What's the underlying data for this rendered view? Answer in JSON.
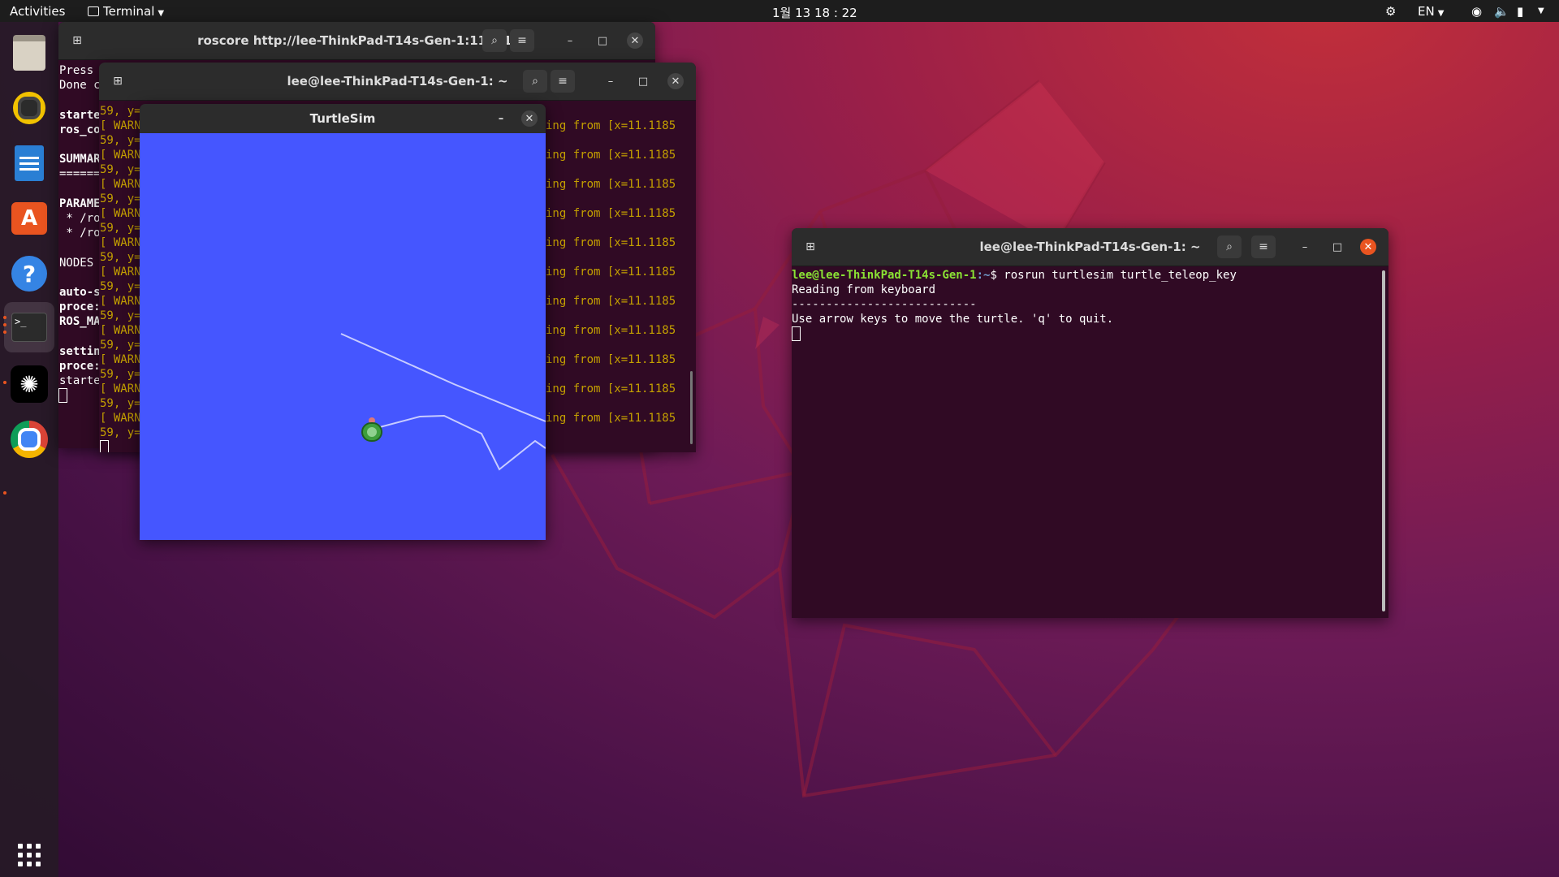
{
  "topbar": {
    "activities": "Activities",
    "app_menu": "Terminal",
    "clock": "1월 13  18 : 22",
    "lang": "EN"
  },
  "dock": {
    "items": [
      "files-icon",
      "rhythmbox-icon",
      "libreoffice-writer-icon",
      "ubuntu-software-icon",
      "help-icon",
      "terminal-icon",
      "chatgpt-icon",
      "chrome-icon"
    ],
    "apps_grid": "show-applications-icon"
  },
  "roscore_window": {
    "title": "roscore http://lee-ThinkPad-T14s-Gen-1:11311/",
    "lines": [
      "Press",
      "Done c",
      "",
      "starte",
      "ros_co",
      "",
      "SUMMAR",
      "======",
      "",
      "PARAME",
      " * /ro",
      " * /ro",
      "",
      "NODES",
      "",
      "auto-s",
      "proce:",
      "ROS_MA",
      "",
      "settin",
      "proce:",
      "starte"
    ]
  },
  "turtlesim_terminal": {
    "title": "lee@lee-ThinkPad-T14s-Gen-1: ~",
    "left_warn_lines": [
      "59, y=",
      "[ WARN",
      "59, y=",
      "[ WARN",
      "59, y=",
      "[ WARN",
      "59, y=",
      "[ WARN",
      "59, y=",
      "[ WARN",
      "59, y=",
      "[ WARN",
      "59, y=",
      "[ WARN",
      "59, y=",
      "[ WARN",
      "59, y=",
      "[ WARN",
      "59, y=",
      "[ WARN",
      "59, y=",
      "[ WARN",
      "59, y="
    ],
    "right_warn_text": "ing from [x=11.1185"
  },
  "turtlesim": {
    "title": "TurtleSim",
    "background": "#4556ff"
  },
  "teleop_window": {
    "title": "lee@lee-ThinkPad-T14s-Gen-1: ~",
    "prompt_user": "lee@lee-ThinkPad-T14s-Gen-1",
    "prompt_path": ":~",
    "command": "$ rosrun turtlesim turtle_teleop_key",
    "line2": "Reading from keyboard",
    "line3": "---------------------------",
    "line4": "Use arrow keys to move the turtle. 'q' to quit."
  },
  "colors": {
    "accent": "#e95420",
    "terminal_bg": "#300a24",
    "warn": "#c4a000",
    "prompt_green": "#8ae234",
    "prompt_blue": "#729fcf"
  }
}
